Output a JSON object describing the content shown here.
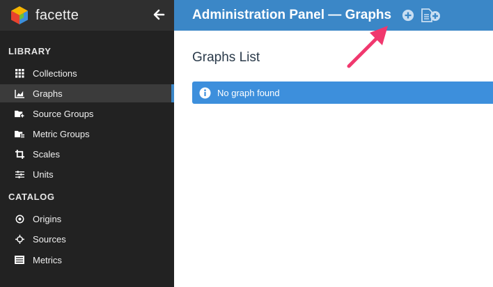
{
  "brand": {
    "name": "facette"
  },
  "sidebar": {
    "library_heading": "LIBRARY",
    "catalog_heading": "CATALOG",
    "library_items": [
      {
        "label": "Collections",
        "icon": "grid-icon"
      },
      {
        "label": "Graphs",
        "icon": "area-chart-icon",
        "active": true
      },
      {
        "label": "Source Groups",
        "icon": "folder-plus-icon"
      },
      {
        "label": "Metric Groups",
        "icon": "folder-list-icon"
      },
      {
        "label": "Scales",
        "icon": "crop-icon"
      },
      {
        "label": "Units",
        "icon": "sliders-icon"
      }
    ],
    "catalog_items": [
      {
        "label": "Origins",
        "icon": "dot-circle-icon"
      },
      {
        "label": "Sources",
        "icon": "crosshairs-icon"
      },
      {
        "label": "Metrics",
        "icon": "list-icon"
      }
    ]
  },
  "header": {
    "title": "Administration Panel — Graphs"
  },
  "main": {
    "page_title": "Graphs List",
    "alert": {
      "text": "No graph found",
      "icon": "info-circle-icon"
    }
  },
  "colors": {
    "sidebar_bg": "#222222",
    "brand_bg": "#2f2f2f",
    "header_bg": "#3b87c7",
    "alert_bg": "#3d8fdc",
    "active_accent": "#3a85c6",
    "annotation_arrow": "#f0386e"
  }
}
